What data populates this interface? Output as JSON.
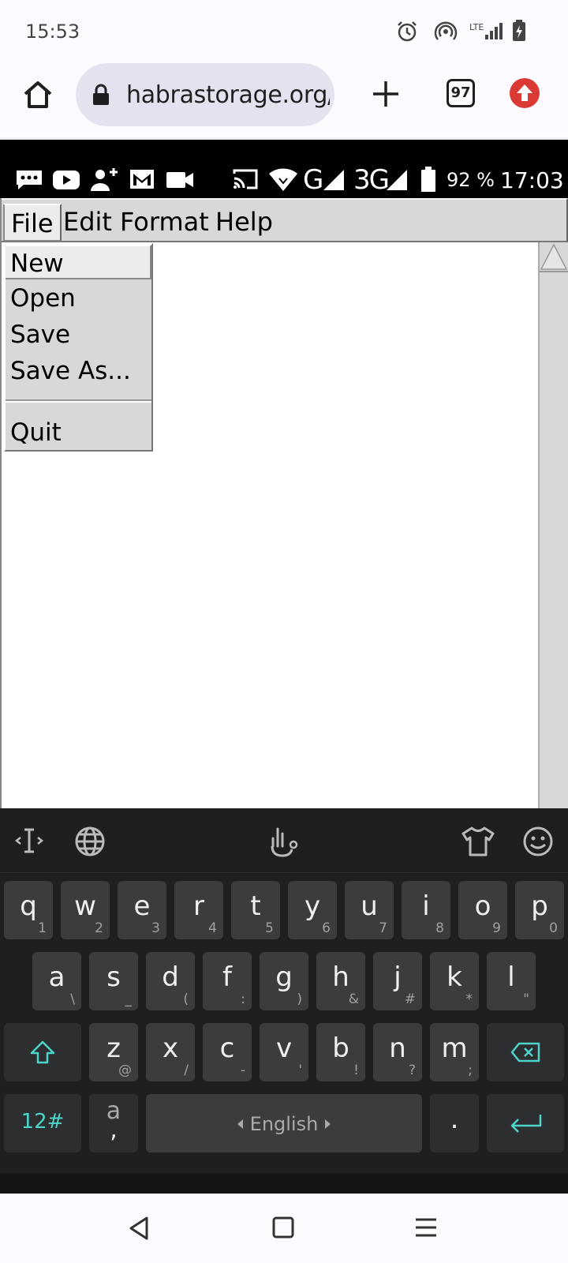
{
  "phone_status": {
    "time": "15:53",
    "icons": [
      "alarm-icon",
      "hotspot-icon",
      "lte-signal-icon",
      "battery-charging-icon"
    ],
    "lte_label": "LTE"
  },
  "browser": {
    "url": "habrastorage.org/",
    "tab_count": "97",
    "icons": [
      "home-icon",
      "lock-icon",
      "new-tab-icon",
      "tabs-icon",
      "update-icon"
    ]
  },
  "emulator_status": {
    "battery_pct": "92 %",
    "time": "17:03",
    "network_g": "G",
    "network_3g": "3G",
    "icons": [
      "messages-icon",
      "youtube-icon",
      "add-contact-icon",
      "gmail-icon",
      "video-icon",
      "cast-icon",
      "wifi-icon",
      "signal-icon",
      "battery-icon"
    ]
  },
  "app": {
    "menubar": [
      "File",
      "Edit",
      "Format",
      "Help"
    ],
    "file_menu": {
      "items": [
        "New",
        "Open",
        "Save",
        "Save As...",
        "Quit"
      ]
    }
  },
  "keyboard": {
    "toolbar": [
      "cursor-icon",
      "globe-icon",
      "voice-gesture-icon",
      "theme-shirt-icon",
      "emoji-icon"
    ],
    "row1": [
      {
        "k": "q",
        "h": "1"
      },
      {
        "k": "w",
        "h": "2"
      },
      {
        "k": "e",
        "h": "3"
      },
      {
        "k": "r",
        "h": "4"
      },
      {
        "k": "t",
        "h": "5"
      },
      {
        "k": "y",
        "h": "6"
      },
      {
        "k": "u",
        "h": "7"
      },
      {
        "k": "i",
        "h": "8"
      },
      {
        "k": "o",
        "h": "9"
      },
      {
        "k": "p",
        "h": "0"
      }
    ],
    "row2": [
      {
        "k": "a",
        "h": "\\"
      },
      {
        "k": "s",
        "h": "_"
      },
      {
        "k": "d",
        "h": "("
      },
      {
        "k": "f",
        "h": ":"
      },
      {
        "k": "g",
        "h": ")"
      },
      {
        "k": "h",
        "h": "&"
      },
      {
        "k": "j",
        "h": "#"
      },
      {
        "k": "k",
        "h": "*"
      },
      {
        "k": "l",
        "h": "\""
      }
    ],
    "row3": [
      {
        "k": "z",
        "h": "@"
      },
      {
        "k": "x",
        "h": "/"
      },
      {
        "k": "c",
        "h": "-"
      },
      {
        "k": "v",
        "h": "'"
      },
      {
        "k": "b",
        "h": "!"
      },
      {
        "k": "n",
        "h": "?"
      },
      {
        "k": "m",
        "h": ";"
      }
    ],
    "symbols_label": "12#",
    "comma_key_top": "a",
    "comma_key_bottom": ",",
    "space_label": "English",
    "period_label": ".",
    "accent_color": "#4dd5c9"
  },
  "navbar": {
    "icons": [
      "back-icon",
      "home-square-icon",
      "menu-icon"
    ]
  }
}
